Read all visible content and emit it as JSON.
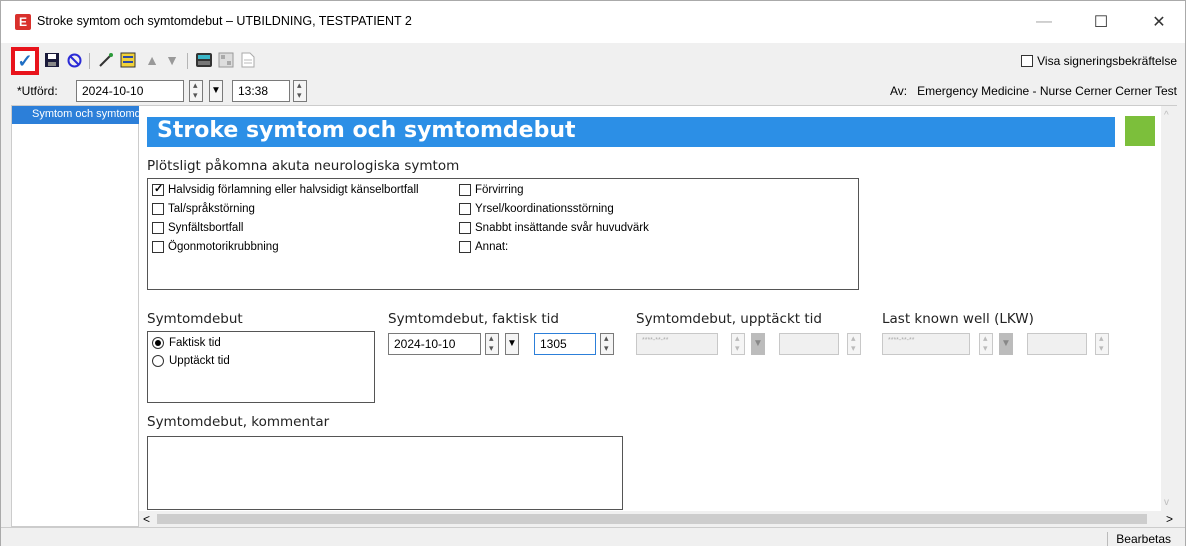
{
  "window": {
    "app_icon": "E",
    "title": "Stroke symtom och symtomdebut – UTBILDNING, TESTPATIENT 2",
    "min_glyph": "—",
    "max_glyph": "☐",
    "close_glyph": "✕"
  },
  "toolbar": {
    "icons": [
      "checkmark-icon",
      "save-icon",
      "cancel-icon",
      "wand-icon",
      "form-icon",
      "arrow-up-icon",
      "arrow-down-icon",
      "calculator-icon",
      "image-icon",
      "document-icon"
    ],
    "sign_confirm_label": "Visa signeringsbekräftelse"
  },
  "header": {
    "performed_label": "*Utförd:",
    "date": "2024-10-10",
    "time": "13:38",
    "by_label": "Av:",
    "by_value": "Emergency Medicine - Nurse Cerner Cerner Test"
  },
  "nav": {
    "items": [
      {
        "label": "Symtom och symtomdebut"
      }
    ]
  },
  "form": {
    "title": "Stroke symtom och symtomdebut",
    "accent": "#2c8fe6",
    "status_color": "#7cbf3b",
    "symptoms": {
      "title": "Plötsligt påkomna akuta neurologiska symtom",
      "left": [
        {
          "label": "Halvsidig förlamning eller halvsidigt känselbortfall",
          "checked": true
        },
        {
          "label": "Tal/språkstörning",
          "checked": false
        },
        {
          "label": "Synfältsbortfall",
          "checked": false
        },
        {
          "label": "Ögonmotorikrubbning",
          "checked": false
        }
      ],
      "right": [
        {
          "label": "Förvirring",
          "checked": false
        },
        {
          "label": "Yrsel/koordinationsstörning",
          "checked": false
        },
        {
          "label": "Snabbt insättande svår huvudvärk",
          "checked": false
        },
        {
          "label": "Annat:",
          "checked": false
        }
      ]
    },
    "onset": {
      "title": "Symtomdebut",
      "options": [
        {
          "label": "Faktisk tid",
          "selected": true
        },
        {
          "label": "Upptäckt tid",
          "selected": false
        }
      ]
    },
    "onset_actual": {
      "title": "Symtomdebut, faktisk tid",
      "date": "2024-10-10",
      "time": "1305"
    },
    "onset_discovered": {
      "title": "Symtomdebut, upptäckt tid",
      "date_placeholder": "****-**-**",
      "time": ""
    },
    "lkw": {
      "title": "Last known well (LKW)",
      "date_placeholder": "****-**-**",
      "time": ""
    },
    "comment": {
      "title": "Symtomdebut, kommentar",
      "value": ""
    }
  },
  "scroll": {
    "left": "<",
    "right": ">",
    "up": "^",
    "down": "v"
  },
  "status": {
    "text": "Bearbetas"
  }
}
